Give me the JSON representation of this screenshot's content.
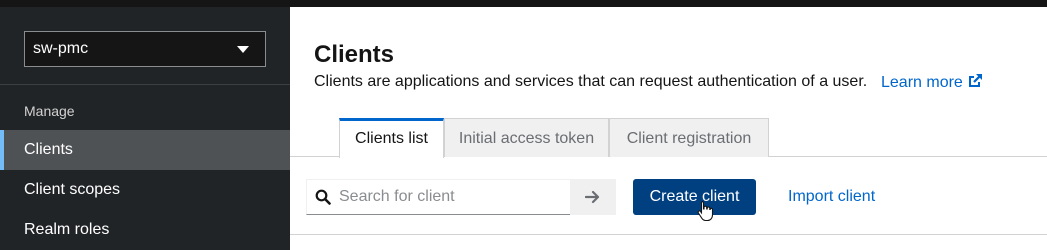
{
  "sidebar": {
    "realm_select": {
      "value": "sw-pmc"
    },
    "section_title": "Manage",
    "items": [
      {
        "label": "Clients",
        "active": true
      },
      {
        "label": "Client scopes",
        "active": false
      },
      {
        "label": "Realm roles",
        "active": false
      }
    ]
  },
  "main": {
    "title": "Clients",
    "description": "Clients are applications and services that can request authentication of a user.",
    "learn_more": "Learn more",
    "tabs": [
      {
        "label": "Clients list",
        "active": true
      },
      {
        "label": "Initial access token",
        "active": false
      },
      {
        "label": "Client registration",
        "active": false
      }
    ],
    "search": {
      "placeholder": "Search for client",
      "value": ""
    },
    "create_button": "Create client",
    "import_button": "Import client"
  },
  "colors": {
    "sidebar_bg": "#212427",
    "active_item_bg": "#4f5255",
    "primary_button": "#004080",
    "link": "#0066cc",
    "active_tab_border": "#0066cc"
  },
  "icons": [
    "caret-down-icon",
    "external-link-icon",
    "search-icon",
    "arrow-right-icon",
    "hand-pointer-cursor-icon"
  ]
}
